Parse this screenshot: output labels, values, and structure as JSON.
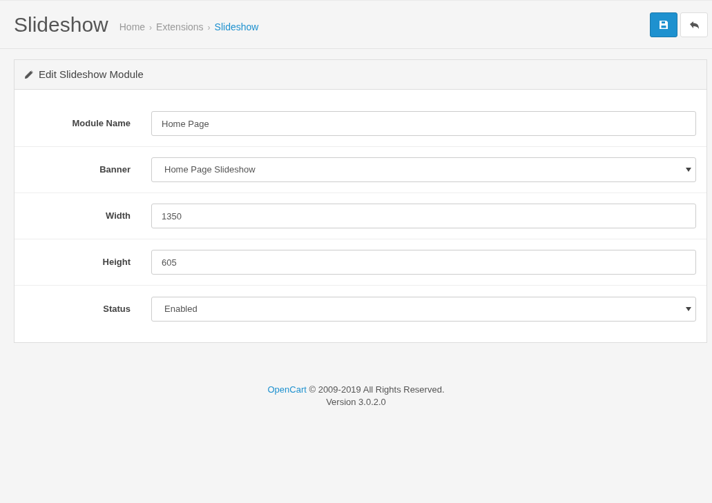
{
  "page_title": "Slideshow",
  "breadcrumb": {
    "separator": "›",
    "items": [
      {
        "label": "Home",
        "current": false
      },
      {
        "label": "Extensions",
        "current": false
      },
      {
        "label": "Slideshow",
        "current": true
      }
    ]
  },
  "panel": {
    "title": "Edit Slideshow Module",
    "fields": [
      {
        "label": "Module Name",
        "kind": "text",
        "value": "Home Page"
      },
      {
        "label": "Banner",
        "kind": "select",
        "value": "Home Page Slideshow"
      },
      {
        "label": "Width",
        "kind": "text",
        "value": "1350"
      },
      {
        "label": "Height",
        "kind": "text",
        "value": "605"
      },
      {
        "label": "Status",
        "kind": "select",
        "value": "Enabled"
      }
    ]
  },
  "footer": {
    "link": "OpenCart",
    "notice": " © 2009-2019 All Rights Reserved.",
    "version": "Version 3.0.2.0"
  }
}
